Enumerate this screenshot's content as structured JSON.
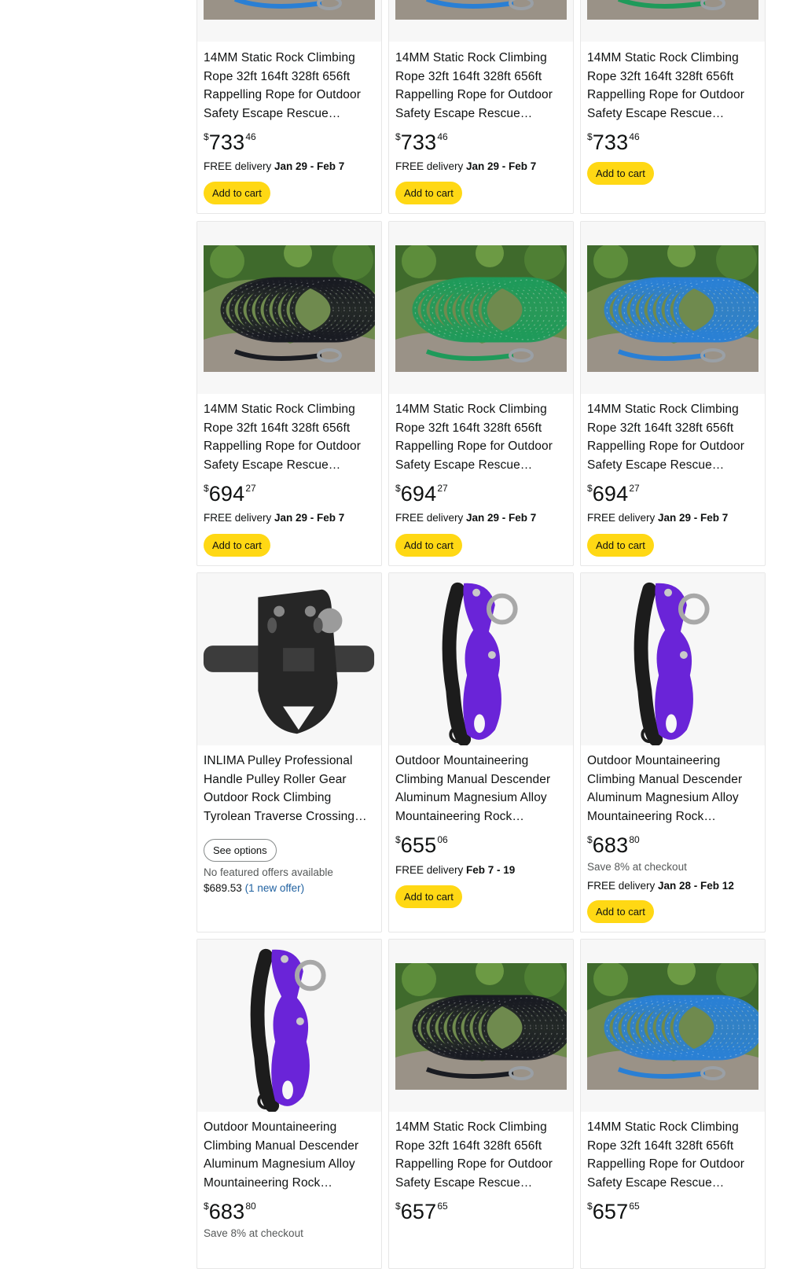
{
  "products": [
    {
      "title": "14MM Static Rock Climbing Rope 32ft 164ft 328ft 656ft Rappelling Rope for Outdoor Safety Escape Rescue…",
      "price_symbol": "$",
      "price_whole": "733",
      "price_fraction": "46",
      "delivery_prefix": "FREE delivery ",
      "delivery_dates": "Jan 29 - Feb 7",
      "button": "Add to cart",
      "image": "rope-blue-icon"
    },
    {
      "title": "14MM Static Rock Climbing Rope 32ft 164ft 328ft 656ft Rappelling Rope for Outdoor Safety Escape Rescue…",
      "price_symbol": "$",
      "price_whole": "733",
      "price_fraction": "46",
      "delivery_prefix": "FREE delivery ",
      "delivery_dates": "Jan 29 - Feb 7",
      "button": "Add to cart",
      "image": "rope-blue-icon"
    },
    {
      "title": "14MM Static Rock Climbing Rope 32ft 164ft 328ft 656ft Rappelling Rope for Outdoor Safety Escape Rescue…",
      "price_symbol": "$",
      "price_whole": "733",
      "price_fraction": "46",
      "button": "Add to cart",
      "image": "rope-green-icon"
    },
    {
      "title": "14MM Static Rock Climbing Rope 32ft 164ft 328ft 656ft Rappelling Rope for Outdoor Safety Escape Rescue…",
      "price_symbol": "$",
      "price_whole": "694",
      "price_fraction": "27",
      "delivery_prefix": "FREE delivery ",
      "delivery_dates": "Jan 29 - Feb 7",
      "button": "Add to cart",
      "image": "rope-black-icon"
    },
    {
      "title": "14MM Static Rock Climbing Rope 32ft 164ft 328ft 656ft Rappelling Rope for Outdoor Safety Escape Rescue…",
      "price_symbol": "$",
      "price_whole": "694",
      "price_fraction": "27",
      "delivery_prefix": "FREE delivery ",
      "delivery_dates": "Jan 29 - Feb 7",
      "button": "Add to cart",
      "image": "rope-green-icon"
    },
    {
      "title": "14MM Static Rock Climbing Rope 32ft 164ft 328ft 656ft Rappelling Rope for Outdoor Safety Escape Rescue…",
      "price_symbol": "$",
      "price_whole": "694",
      "price_fraction": "27",
      "delivery_prefix": "FREE delivery ",
      "delivery_dates": "Jan 29 - Feb 7",
      "button": "Add to cart",
      "image": "rope-blue-icon"
    },
    {
      "title": "INLIMA Pulley Professional Handle Pulley Roller Gear Outdoor Rock Climbing Tyrolean Traverse Crossing…",
      "button": "See options",
      "no_offers": "No featured offers available",
      "offer_price": "$689.53",
      "offer_link": "(1 new offer)",
      "image": "pulley-icon"
    },
    {
      "title": "Outdoor Mountaineering Climbing Manual Descender Aluminum Magnesium Alloy Mountaineering Rock…",
      "price_symbol": "$",
      "price_whole": "655",
      "price_fraction": "06",
      "delivery_prefix": "FREE delivery ",
      "delivery_dates": "Feb 7 - 19",
      "button": "Add to cart",
      "image": "descender-icon"
    },
    {
      "title": "Outdoor Mountaineering Climbing Manual Descender Aluminum Magnesium Alloy Mountaineering Rock…",
      "price_symbol": "$",
      "price_whole": "683",
      "price_fraction": "80",
      "save_text": "Save 8% at checkout",
      "delivery_prefix": "FREE delivery ",
      "delivery_dates": "Jan 28 - Feb 12",
      "button": "Add to cart",
      "image": "descender-icon"
    },
    {
      "title": "Outdoor Mountaineering Climbing Manual Descender Aluminum Magnesium Alloy Mountaineering Rock…",
      "price_symbol": "$",
      "price_whole": "683",
      "price_fraction": "80",
      "save_text": "Save 8% at checkout",
      "image": "descender-icon"
    },
    {
      "title": "14MM Static Rock Climbing Rope 32ft 164ft 328ft 656ft Rappelling Rope for Outdoor Safety Escape Rescue…",
      "price_symbol": "$",
      "price_whole": "657",
      "price_fraction": "65",
      "image": "rope-black-icon"
    },
    {
      "title": "14MM Static Rock Climbing Rope 32ft 164ft 328ft 656ft Rappelling Rope for Outdoor Safety Escape Rescue…",
      "price_symbol": "$",
      "price_whole": "657",
      "price_fraction": "65",
      "image": "rope-blue-icon"
    }
  ],
  "colors": {
    "cart_button": "#ffd814",
    "link": "#2162a1",
    "muted": "#565959",
    "rope_blue": "#2a7fd4",
    "rope_green": "#1f9a5a",
    "rope_black": "#1a1c22",
    "descender_purple": "#6a24d8"
  }
}
